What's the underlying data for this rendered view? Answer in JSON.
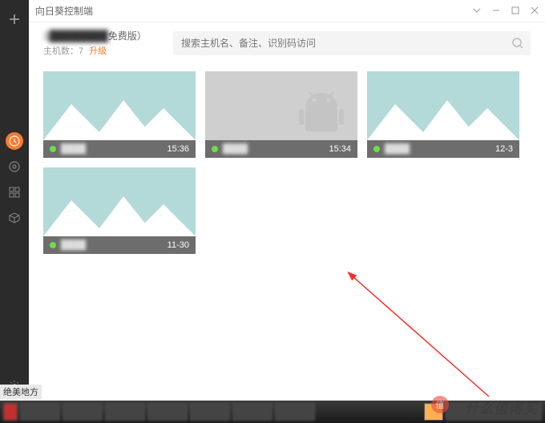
{
  "window": {
    "title": "向日葵控制端"
  },
  "header": {
    "plan_text": "1████████",
    "plan_suffix": "免费版）",
    "host_count_label": "主机数：7",
    "upgrade_label": "升级"
  },
  "search": {
    "placeholder": "搜索主机名、备注、识别码访问"
  },
  "cards": [
    {
      "name": "████",
      "time": "15:36",
      "type": "pc",
      "online": true
    },
    {
      "name": "████",
      "time": "15:34",
      "type": "android",
      "online": true
    },
    {
      "name": "████",
      "time": "12-3",
      "type": "pc",
      "online": true
    },
    {
      "name": "████",
      "time": "11-30",
      "type": "pc",
      "online": true
    }
  ],
  "bottom_text": "绝美地方",
  "watermark": {
    "badge": "值",
    "text": "什么值得买"
  }
}
